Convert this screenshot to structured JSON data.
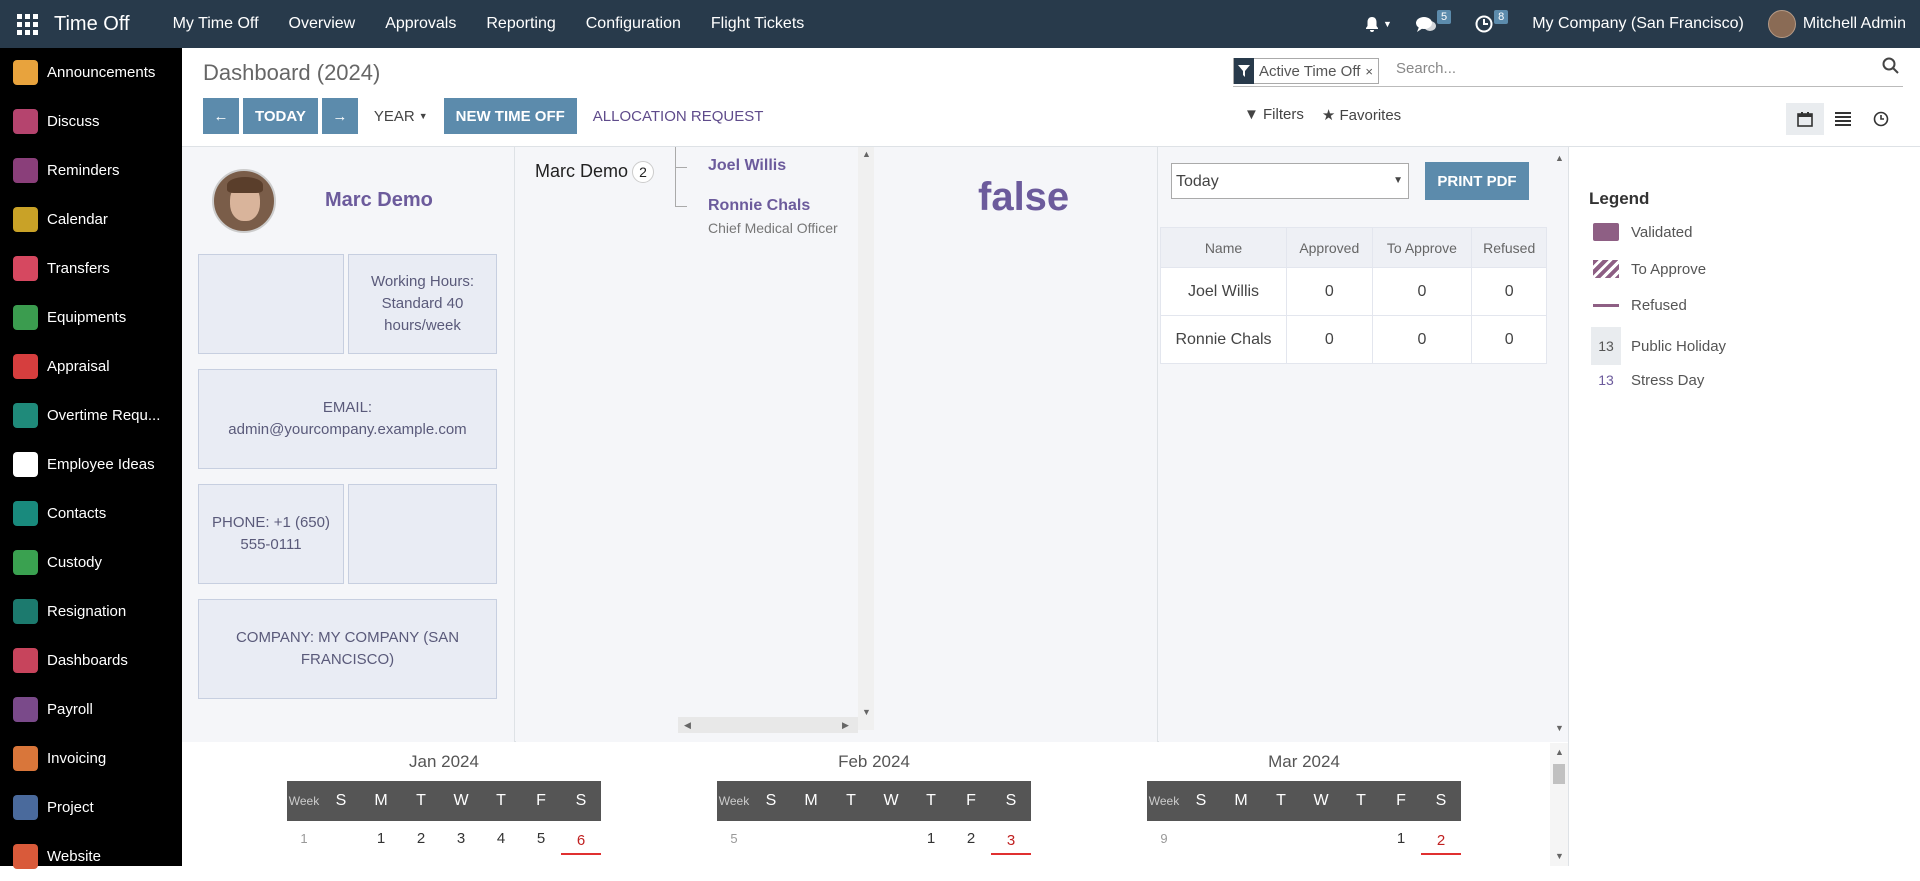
{
  "topbar": {
    "app_title": "Time Off",
    "menu": [
      "My Time Off",
      "Overview",
      "Approvals",
      "Reporting",
      "Configuration",
      "Flight Tickets"
    ],
    "chat_count": "5",
    "activity_count": "8",
    "company": "My Company (San Francisco)",
    "user": "Mitchell Admin"
  },
  "sidebar": {
    "items": [
      {
        "label": "Announcements",
        "color": "#e8a33d"
      },
      {
        "label": "Discuss",
        "color": "#b5446e"
      },
      {
        "label": "Reminders",
        "color": "#8a3f7a"
      },
      {
        "label": "Calendar",
        "color": "#c9a227"
      },
      {
        "label": "Transfers",
        "color": "#d64860"
      },
      {
        "label": "Equipments",
        "color": "#3b9c4f"
      },
      {
        "label": "Appraisal",
        "color": "#d63e3e"
      },
      {
        "label": "Overtime Requ...",
        "color": "#1f8a7a"
      },
      {
        "label": "Employee Ideas",
        "color": "#ffffff"
      },
      {
        "label": "Contacts",
        "color": "#198a7d"
      },
      {
        "label": "Custody",
        "color": "#3aa150"
      },
      {
        "label": "Resignation",
        "color": "#1c7a6e"
      },
      {
        "label": "Dashboards",
        "color": "#c7445c"
      },
      {
        "label": "Payroll",
        "color": "#7a4a8a"
      },
      {
        "label": "Invoicing",
        "color": "#d9763a"
      },
      {
        "label": "Project",
        "color": "#4a6a9c"
      },
      {
        "label": "Website",
        "color": "#d95a3a"
      }
    ]
  },
  "controlpanel": {
    "title": "Dashboard (2024)",
    "facet": "Active Time Off",
    "search_placeholder": "Search...",
    "prev_label": "←",
    "today_label": "TODAY",
    "next_label": "→",
    "scale_label": "YEAR",
    "new_label": "NEW TIME OFF",
    "alloc_label": "ALLOCATION REQUEST",
    "filters_label": "Filters",
    "favorites_label": "Favorites"
  },
  "employee": {
    "name": "Marc Demo",
    "working_hours": "Working Hours: Standard 40 hours/week",
    "email": "EMAIL: admin@yourcompany.example.com",
    "phone": "PHONE: +1 (650) 555-0111",
    "company": "COMPANY: MY COMPANY (SAN FRANCISCO)"
  },
  "org": {
    "me": "Marc Demo",
    "count": "2",
    "subs": [
      {
        "name": "Joel Willis",
        "job": ""
      },
      {
        "name": "Ronnie Chals",
        "job": "Chief Medical Officer"
      }
    ]
  },
  "false_value": "false",
  "report": {
    "select_value": "Today",
    "print_label": "PRINT PDF",
    "headers": [
      "Name",
      "Approved",
      "To Approve",
      "Refused"
    ],
    "rows": [
      [
        "Joel Willis",
        "0",
        "0",
        "0"
      ],
      [
        "Ronnie Chals",
        "0",
        "0",
        "0"
      ]
    ]
  },
  "legend": {
    "title": "Legend",
    "items": [
      {
        "label": "Validated"
      },
      {
        "label": "To Approve"
      },
      {
        "label": "Refused"
      },
      {
        "label": "Public Holiday",
        "num": "13"
      },
      {
        "label": "Stress Day",
        "num": "13"
      }
    ]
  },
  "calendar": {
    "week_label": "Week",
    "weekdays": [
      "S",
      "M",
      "T",
      "W",
      "T",
      "F",
      "S"
    ],
    "months": [
      {
        "title": "Jan 2024",
        "week": "1",
        "days": [
          "",
          "1",
          "2",
          "3",
          "4",
          "5",
          "6"
        ]
      },
      {
        "title": "Feb 2024",
        "week": "5",
        "days": [
          "",
          "",
          "",
          "",
          "1",
          "2",
          "3"
        ]
      },
      {
        "title": "Mar 2024",
        "week": "9",
        "days": [
          "",
          "",
          "",
          "",
          "",
          "1",
          "2"
        ]
      }
    ]
  }
}
